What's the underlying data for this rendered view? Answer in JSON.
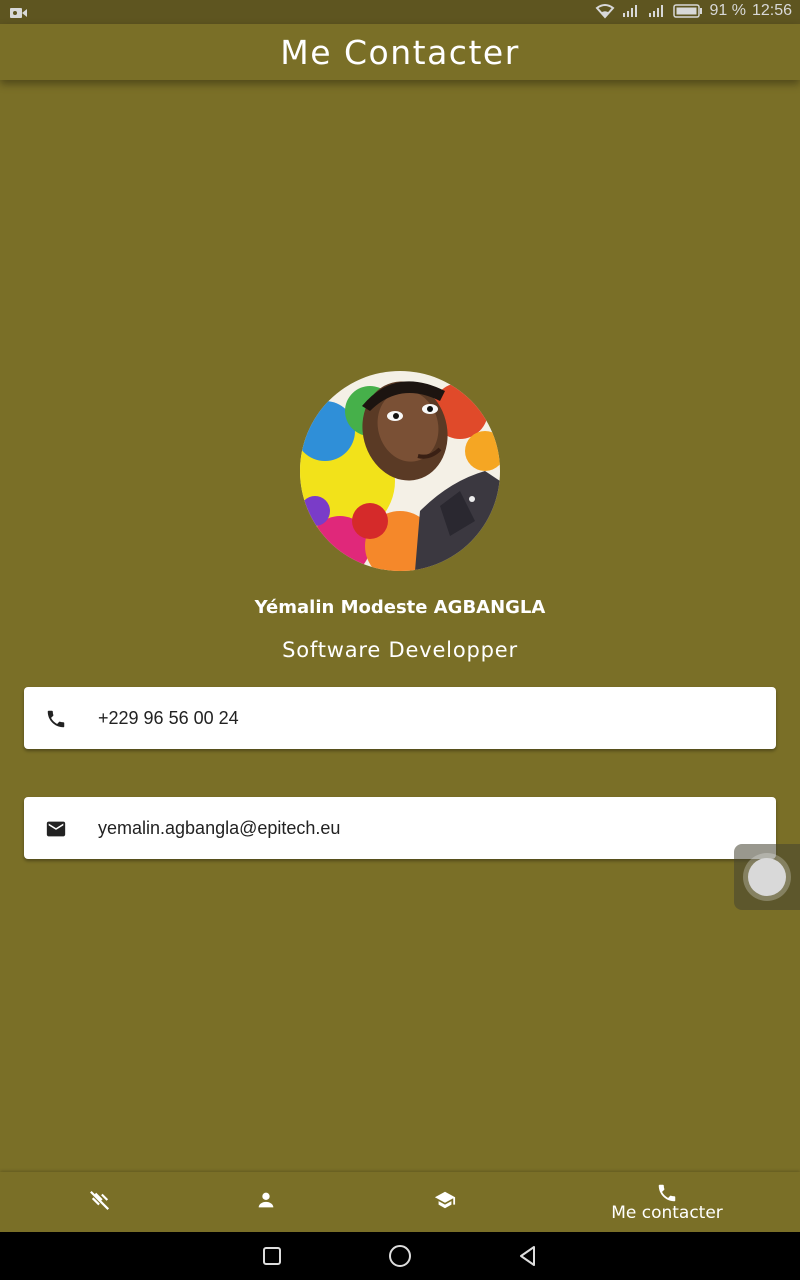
{
  "status_bar": {
    "battery": "91 %",
    "time": "12:56"
  },
  "app_bar": {
    "title": "Me Contacter"
  },
  "profile": {
    "name": "Yémalin Modeste AGBANGLA",
    "role": "Software Developper"
  },
  "contacts": {
    "phone": "+229 96 56 00 24",
    "email": "yemalin.agbangla@epitech.eu"
  },
  "bottom_nav": {
    "items": [
      {
        "icon": "skills-icon",
        "label": ""
      },
      {
        "icon": "person-icon",
        "label": ""
      },
      {
        "icon": "school-icon",
        "label": ""
      },
      {
        "icon": "phone-icon",
        "label": "Me contacter"
      }
    ],
    "active_index": 3
  },
  "colors": {
    "primary": "#7A6F27",
    "status_bar": "#5E5520",
    "card": "#FFFFFF"
  }
}
